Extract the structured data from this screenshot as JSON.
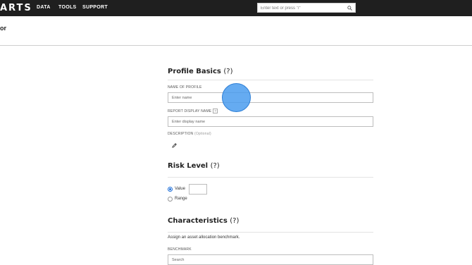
{
  "app": {
    "logo_text": "ARTS"
  },
  "nav": {
    "items": [
      {
        "label": "DATA"
      },
      {
        "label": "TOOLS"
      },
      {
        "label": "SUPPORT"
      }
    ]
  },
  "search": {
    "placeholder": "Enter text or press \"/\"",
    "icon": "search-icon"
  },
  "page": {
    "title": "or"
  },
  "profile_basics": {
    "title": "Profile Basics",
    "help": "(?)",
    "name_label": "NAME OF PROFILE",
    "name_placeholder": "Enter name",
    "display_label": "REPORT DISPLAY NAME",
    "display_help": "?",
    "display_placeholder": "Enter display name",
    "description_label": "DESCRIPTION",
    "description_optional": "(Optional)",
    "edit_icon": "pencil-icon"
  },
  "risk_level": {
    "title": "Risk Level",
    "help": "(?)",
    "options": [
      {
        "label": "Value",
        "selected": true
      },
      {
        "label": "Range",
        "selected": false
      }
    ],
    "value": ""
  },
  "characteristics": {
    "title": "Characteristics",
    "help": "(?)",
    "description": "Assign an asset allocation benchmark.",
    "benchmark_label": "BENCHMARK",
    "benchmark_placeholder": "Search"
  },
  "colors": {
    "topbar": "#1f1f1f",
    "accent": "#1e6fd9",
    "cursor": "#4a9cee"
  }
}
